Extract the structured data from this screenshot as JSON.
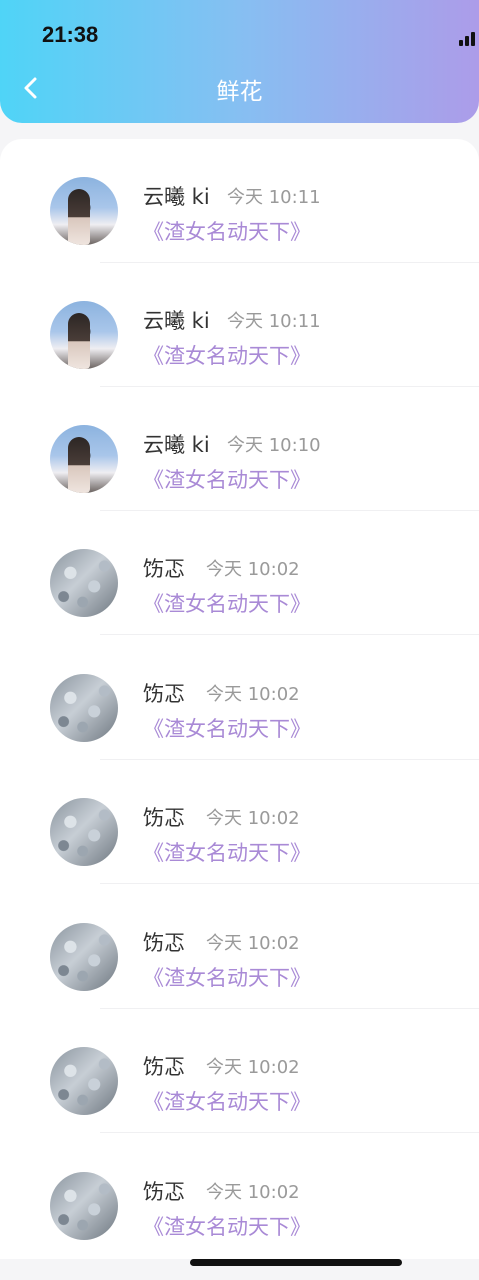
{
  "status": {
    "time": "21:38"
  },
  "header": {
    "title": "鲜花"
  },
  "icons": {
    "back": "chevron-left-icon",
    "signal": "signal-bars-icon"
  },
  "colors": {
    "header_gradient_start": "#4fd4f7",
    "header_gradient_end": "#ac9ce9",
    "accent_book": "#a98ad6",
    "time_text": "#9a9a9a"
  },
  "rows": [
    {
      "name": "云曦 ki",
      "time": "今天 10:11",
      "book": "《渣女名动天下》",
      "avatar": "girl"
    },
    {
      "name": "云曦 ki",
      "time": "今天 10:11",
      "book": "《渣女名动天下》",
      "avatar": "girl"
    },
    {
      "name": "云曦 ki",
      "time": "今天 10:10",
      "book": "《渣女名动天下》",
      "avatar": "girl"
    },
    {
      "name": "饬忑",
      "time": "今天 10:02",
      "book": "《渣女名动天下》",
      "avatar": "glitter"
    },
    {
      "name": "饬忑",
      "time": "今天 10:02",
      "book": "《渣女名动天下》",
      "avatar": "glitter"
    },
    {
      "name": "饬忑",
      "time": "今天 10:02",
      "book": "《渣女名动天下》",
      "avatar": "glitter"
    },
    {
      "name": "饬忑",
      "time": "今天 10:02",
      "book": "《渣女名动天下》",
      "avatar": "glitter"
    },
    {
      "name": "饬忑",
      "time": "今天 10:02",
      "book": "《渣女名动天下》",
      "avatar": "glitter"
    },
    {
      "name": "饬忑",
      "time": "今天 10:02",
      "book": "《渣女名动天下》",
      "avatar": "glitter"
    }
  ]
}
